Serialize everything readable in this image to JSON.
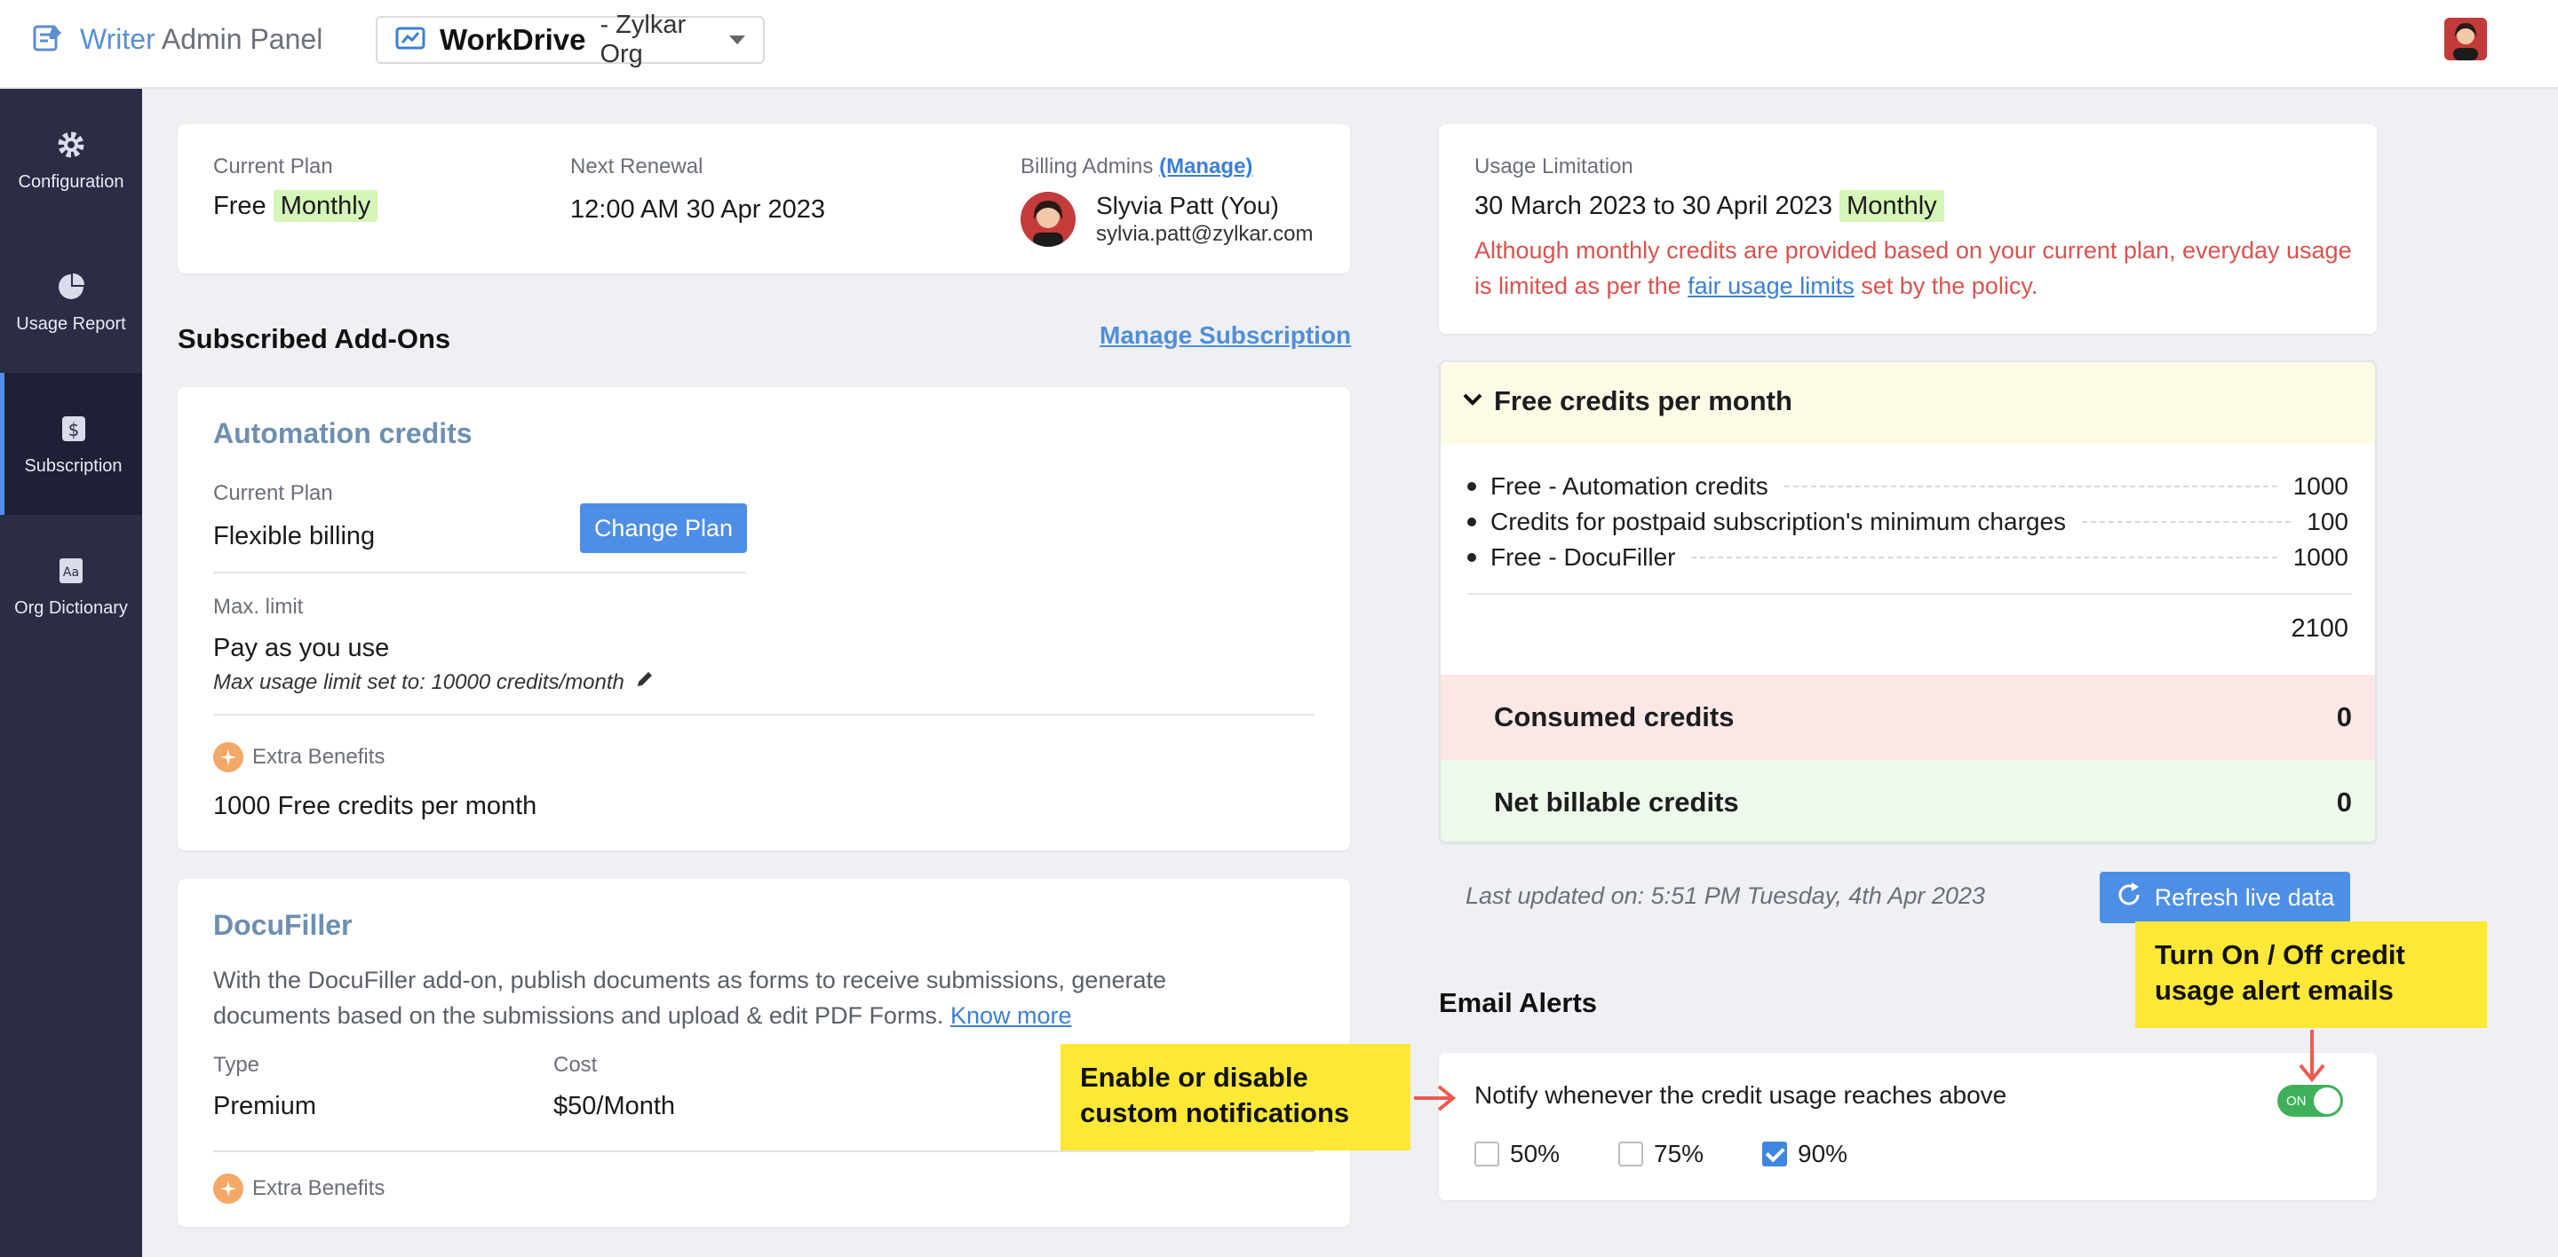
{
  "header": {
    "brand_writer": "Writer",
    "brand_admin": "Admin Panel",
    "app_name": "WorkDrive",
    "org_name": "- Zylkar Org"
  },
  "sidebar": {
    "items": [
      {
        "label": "Configuration",
        "icon": "gear-icon"
      },
      {
        "label": "Usage Report",
        "icon": "pie-chart-icon"
      },
      {
        "label": "Subscription",
        "icon": "dollar-icon"
      },
      {
        "label": "Org Dictionary",
        "icon": "dictionary-icon"
      }
    ],
    "active": "Subscription"
  },
  "plan": {
    "current_plan_label": "Current Plan",
    "current_plan_value": "Free",
    "current_plan_badge": "Monthly",
    "next_renewal_label": "Next Renewal",
    "next_renewal_value": "12:00 AM 30 Apr 2023",
    "billing_admins_label": "Billing Admins",
    "manage_link": "(Manage)",
    "admin_name": "Slyvia Patt (You)",
    "admin_email": "sylvia.patt@zylkar.com"
  },
  "addons": {
    "title": "Subscribed Add-Ons",
    "manage_subscription": "Manage Subscription",
    "automation": {
      "title": "Automation credits",
      "current_plan_label": "Current Plan",
      "current_plan_value": "Flexible billing",
      "change_plan": "Change Plan",
      "max_limit_label": "Max. limit",
      "max_limit_value": "Pay as you use",
      "max_limit_note": "Max usage limit set to: 10000 credits/month",
      "extra_benefits_label": "Extra Benefits",
      "extra_benefits_value": "1000 Free credits per month"
    },
    "docufiller": {
      "title": "DocuFiller",
      "description": "With the DocuFiller add-on, publish documents as forms to receive submissions, generate documents based on the submissions and upload & edit PDF Forms.",
      "know_more": "Know more",
      "type_label": "Type",
      "type_value": "Premium",
      "cost_label": "Cost",
      "cost_value": "$50/Month",
      "extra_benefits_label": "Extra Benefits"
    }
  },
  "usage": {
    "label": "Usage Limitation",
    "period": "30 March 2023 to 30 April 2023",
    "badge": "Monthly",
    "warning_pre": "Although monthly credits are provided based on your current plan, everyday usage is limited as per the",
    "warning_link": "fair usage limits",
    "warning_post": "set by the policy."
  },
  "credits": {
    "header": "Free credits per month",
    "items": [
      {
        "name": "Free - Automation credits",
        "value": "1000"
      },
      {
        "name": "Credits for postpaid subscription's minimum charges",
        "value": "100"
      },
      {
        "name": "Free - DocuFiller",
        "value": "1000"
      }
    ],
    "total": "2100",
    "consumed_label": "Consumed credits",
    "consumed_value": "0",
    "net_label": "Net billable credits",
    "net_value": "0",
    "last_updated": "Last updated on: 5:51 PM Tuesday, 4th Apr 2023",
    "refresh_button": "Refresh live data"
  },
  "email_alerts": {
    "title": "Email Alerts",
    "notify_text": "Notify whenever the credit usage reaches above",
    "toggle_label": "ON",
    "toggle_on": true,
    "options": [
      {
        "label": "50%",
        "checked": false
      },
      {
        "label": "75%",
        "checked": false
      },
      {
        "label": "90%",
        "checked": true
      }
    ]
  },
  "callouts": {
    "toggle_hint": "Turn On / Off credit usage alert emails",
    "notify_hint": "Enable or disable custom notifications"
  },
  "colors": {
    "sidebar_bg": "#2b2d45",
    "accent": "#4d8fe6",
    "highlight": "#d6f5b8",
    "warning_text": "#d9534f",
    "callout": "#ffe836"
  }
}
